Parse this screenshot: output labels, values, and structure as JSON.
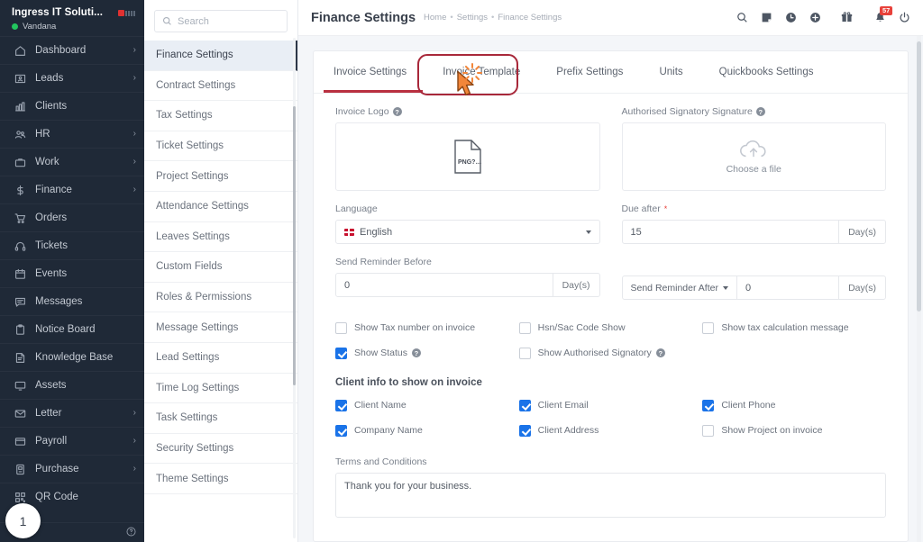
{
  "sidebar": {
    "company": "Ingress IT Soluti...",
    "user": "Vandana",
    "items": [
      {
        "label": "Dashboard",
        "icon": "home-icon",
        "caret": "›"
      },
      {
        "label": "Leads",
        "icon": "leads-icon",
        "caret": "›"
      },
      {
        "label": "Clients",
        "icon": "clients-icon",
        "caret": ""
      },
      {
        "label": "HR",
        "icon": "hr-icon",
        "caret": "›"
      },
      {
        "label": "Work",
        "icon": "work-icon",
        "caret": "›"
      },
      {
        "label": "Finance",
        "icon": "dollar-icon",
        "caret": "›"
      },
      {
        "label": "Orders",
        "icon": "cart-icon",
        "caret": ""
      },
      {
        "label": "Tickets",
        "icon": "headset-icon",
        "caret": ""
      },
      {
        "label": "Events",
        "icon": "calendar-icon",
        "caret": ""
      },
      {
        "label": "Messages",
        "icon": "message-icon",
        "caret": ""
      },
      {
        "label": "Notice Board",
        "icon": "clipboard-icon",
        "caret": ""
      },
      {
        "label": "Knowledge Base",
        "icon": "book-icon",
        "caret": ""
      },
      {
        "label": "Assets",
        "icon": "monitor-icon",
        "caret": ""
      },
      {
        "label": "Letter",
        "icon": "envelope-icon",
        "caret": "›"
      },
      {
        "label": "Payroll",
        "icon": "wallet-icon",
        "caret": "›"
      },
      {
        "label": "Purchase",
        "icon": "purchase-icon",
        "caret": "›"
      },
      {
        "label": "QR Code",
        "icon": "qr-icon",
        "caret": ""
      }
    ],
    "step_badge": "1",
    "help_icon": "question-circle-icon"
  },
  "settings_panel": {
    "search_placeholder": "Search",
    "search_value": "",
    "items": [
      "Finance Settings",
      "Contract Settings",
      "Tax Settings",
      "Ticket Settings",
      "Project Settings",
      "Attendance Settings",
      "Leaves Settings",
      "Custom Fields",
      "Roles & Permissions",
      "Message Settings",
      "Lead Settings",
      "Time Log Settings",
      "Task Settings",
      "Security Settings",
      "Theme Settings"
    ],
    "active": "Finance Settings"
  },
  "topbar": {
    "title": "Finance Settings",
    "breadcrumbs": [
      "Home",
      "Settings",
      "Finance Settings"
    ],
    "separator": "•",
    "icons": [
      "search-icon",
      "note-icon",
      "clock-icon",
      "plus-circle-icon",
      "gift-icon",
      "bell-icon",
      "power-icon"
    ],
    "notification_count": "57"
  },
  "tabs": [
    {
      "label": "Invoice Settings",
      "active": false
    },
    {
      "label": "Invoice Template",
      "active": true
    },
    {
      "label": "Prefix Settings",
      "active": false
    },
    {
      "label": "Units",
      "active": false
    },
    {
      "label": "Quickbooks Settings",
      "active": false
    }
  ],
  "form": {
    "invoice_logo": {
      "label": "Invoice Logo",
      "help": "?",
      "file_type": "PNG?..."
    },
    "signature": {
      "label": "Authorised Signatory Signature",
      "help": "?",
      "upload_label": "Choose a file"
    },
    "language": {
      "label": "Language",
      "value": "English"
    },
    "due_after": {
      "label": "Due after",
      "required": "*",
      "value": "15",
      "unit": "Day(s)"
    },
    "reminder_before": {
      "label": "Send Reminder Before",
      "value": "0",
      "unit": "Day(s)"
    },
    "reminder_after": {
      "prefix": "Send Reminder After",
      "value": "0",
      "unit": "Day(s)"
    },
    "option_checks": [
      {
        "label": "Show Tax number on invoice",
        "checked": false,
        "help": false
      },
      {
        "label": "Show Status",
        "checked": true,
        "help": true
      },
      {
        "label": "Hsn/Sac Code Show",
        "checked": false,
        "help": false
      },
      {
        "label": "Show Authorised Signatory",
        "checked": false,
        "help": true
      },
      {
        "label": "Show tax calculation message",
        "checked": false,
        "help": false
      }
    ],
    "client_info": {
      "title": "Client info to show on invoice",
      "checks": [
        {
          "label": "Client Name",
          "checked": true
        },
        {
          "label": "Company Name",
          "checked": true
        },
        {
          "label": "Client Email",
          "checked": true
        },
        {
          "label": "Client Address",
          "checked": true
        },
        {
          "label": "Client Phone",
          "checked": true
        },
        {
          "label": "Show Project on invoice",
          "checked": false
        }
      ]
    },
    "terms": {
      "label": "Terms and Conditions",
      "value": "Thank you for your business."
    }
  },
  "annotation": {
    "highlight_target": "Invoice Template",
    "color": "#a8283a",
    "cursor": "click-cursor"
  }
}
